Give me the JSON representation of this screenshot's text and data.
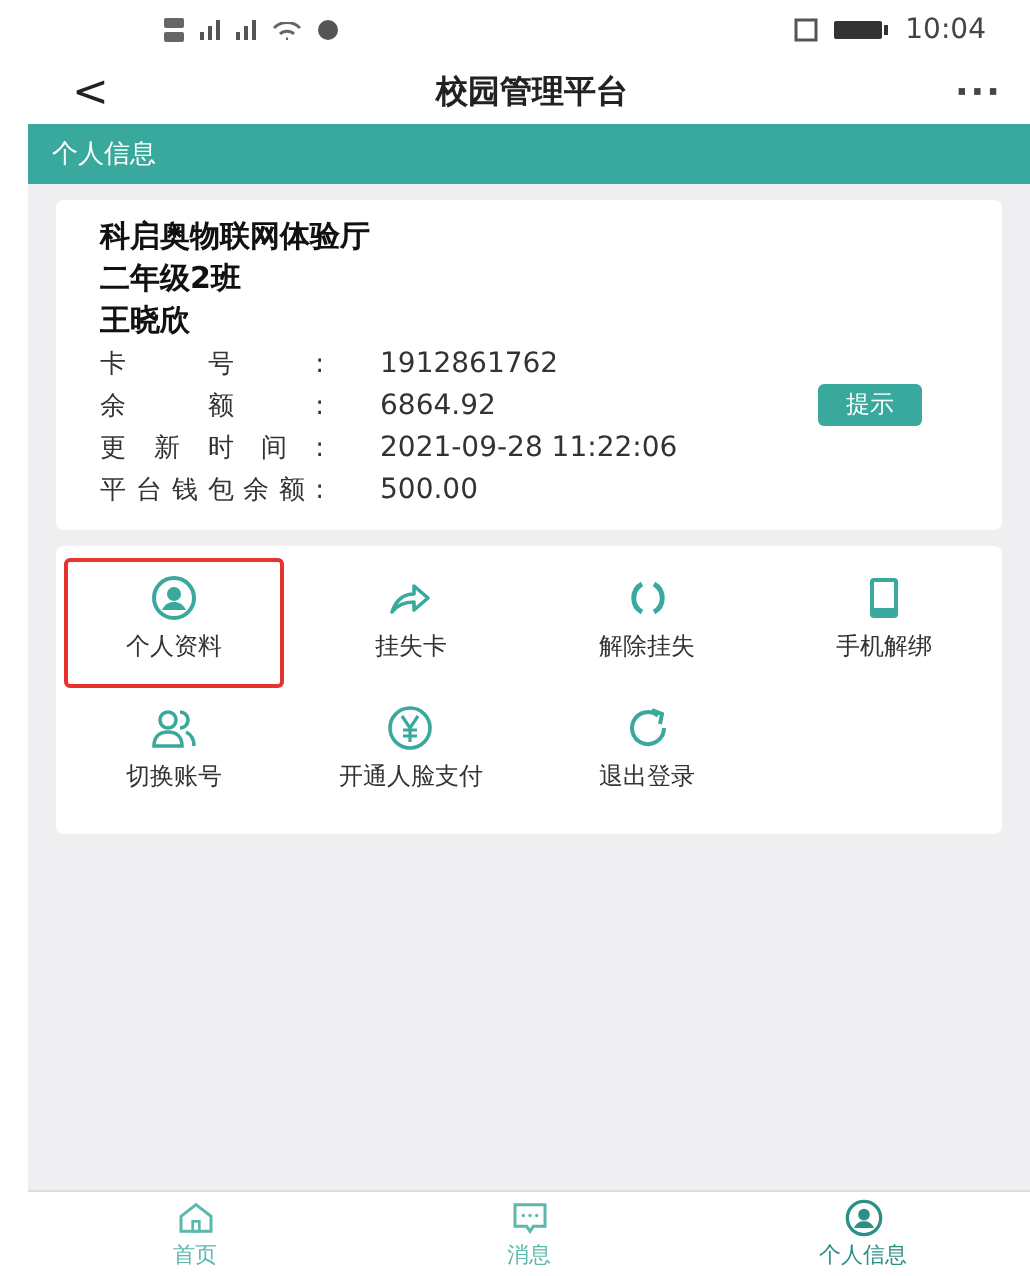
{
  "status_bar": {
    "time": "10:04"
  },
  "header": {
    "back": "<",
    "title": "校园管理平台",
    "more": "···"
  },
  "section_title": "个人信息",
  "profile": {
    "school": "科启奥物联网体验厅",
    "class": "二年级2班",
    "name": "王晓欣",
    "fields": [
      {
        "label": "卡号:",
        "value": "1912861762"
      },
      {
        "label": "余额:",
        "value": "6864.92",
        "button": "提示"
      },
      {
        "label": "更新时间:",
        "value": "2021-09-28 11:22:06"
      },
      {
        "label": "平台钱包余额:",
        "value": "500.00"
      }
    ]
  },
  "actions": [
    {
      "label": "个人资料",
      "selected": true
    },
    {
      "label": "挂失卡",
      "selected": false
    },
    {
      "label": "解除挂失",
      "selected": false
    },
    {
      "label": "手机解绑",
      "selected": false
    },
    {
      "label": "切换账号",
      "selected": false
    },
    {
      "label": "开通人脸支付",
      "selected": false
    },
    {
      "label": "退出登录",
      "selected": false
    }
  ],
  "tab_bar": [
    {
      "label": "首页",
      "selected": false
    },
    {
      "label": "消息",
      "selected": false
    },
    {
      "label": "个人信息",
      "selected": true
    }
  ]
}
